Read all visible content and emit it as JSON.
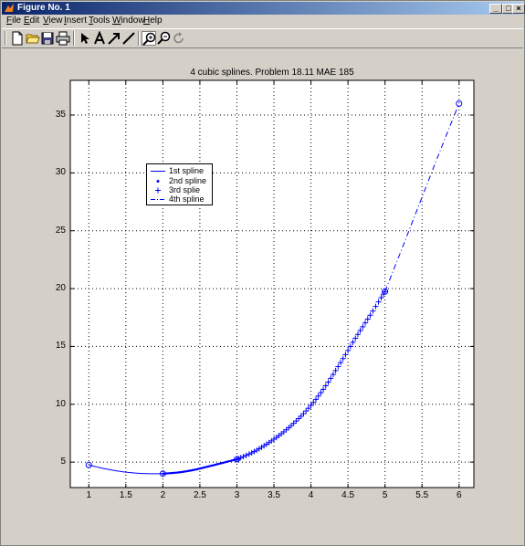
{
  "window": {
    "title": "Figure No. 1",
    "min_glyph": "_",
    "max_glyph": "□",
    "close_glyph": "×"
  },
  "menu": [
    {
      "label": "File",
      "mnemonic": "F",
      "rest": "ile"
    },
    {
      "label": "Edit",
      "mnemonic": "E",
      "rest": "dit"
    },
    {
      "label": "View",
      "mnemonic": "V",
      "rest": "iew"
    },
    {
      "label": "Insert",
      "mnemonic": "I",
      "rest": "nsert"
    },
    {
      "label": "Tools",
      "mnemonic": "T",
      "rest": "ools"
    },
    {
      "label": "Window",
      "mnemonic": "W",
      "rest": "indow"
    },
    {
      "label": "Help",
      "mnemonic": "H",
      "rest": "elp"
    }
  ],
  "toolbar": [
    "new-file-icon",
    "open-folder-icon",
    "save-icon",
    "print-icon",
    "pointer-arrow-icon",
    "text-a-icon",
    "arrow-icon",
    "line-icon",
    "zoom-in-icon",
    "zoom-out-icon",
    "rotate-icon"
  ],
  "chart_data": {
    "type": "line",
    "title": "4 cubic splines. Problem 18.11 MAE 185",
    "xlim": [
      0.75,
      6.2
    ],
    "ylim": [
      2.8,
      38
    ],
    "xticks": [
      "1",
      "1.5",
      "2",
      "2.5",
      "3",
      "3.5",
      "4",
      "4.5",
      "5",
      "5.5",
      "6"
    ],
    "yticks": [
      "5",
      "10",
      "15",
      "20",
      "25",
      "30",
      "35"
    ],
    "grid": true,
    "legend_position": "upper-left",
    "color": "#0000ff",
    "knots": [
      [
        1,
        4.75
      ],
      [
        2,
        4.0
      ],
      [
        3,
        5.25
      ],
      [
        5,
        19.75
      ],
      [
        6,
        36.0
      ]
    ],
    "series": [
      {
        "name": "1st spline",
        "style": "solid",
        "x": [
          1,
          1.2,
          1.4,
          1.6,
          1.8,
          2
        ],
        "y": [
          4.75,
          4.45,
          4.22,
          4.07,
          4.0,
          4.0
        ]
      },
      {
        "name": "2nd spline",
        "style": "dot",
        "x": [
          2,
          2.2,
          2.4,
          2.6,
          2.8,
          3
        ],
        "y": [
          4.0,
          4.1,
          4.3,
          4.6,
          4.92,
          5.25
        ]
      },
      {
        "name": "3rd splie",
        "style": "plus",
        "x": [
          3,
          3.2,
          3.4,
          3.6,
          3.8,
          4,
          4.2,
          4.4,
          4.6,
          4.8,
          5
        ],
        "y": [
          5.25,
          5.8,
          6.55,
          7.45,
          8.55,
          9.9,
          11.6,
          13.6,
          15.7,
          17.7,
          19.75
        ]
      },
      {
        "name": "4th spline",
        "style": "dashdot",
        "x": [
          5,
          5.25,
          5.5,
          5.75,
          6
        ],
        "y": [
          19.75,
          23.8,
          27.9,
          32.0,
          36.0
        ]
      }
    ]
  }
}
